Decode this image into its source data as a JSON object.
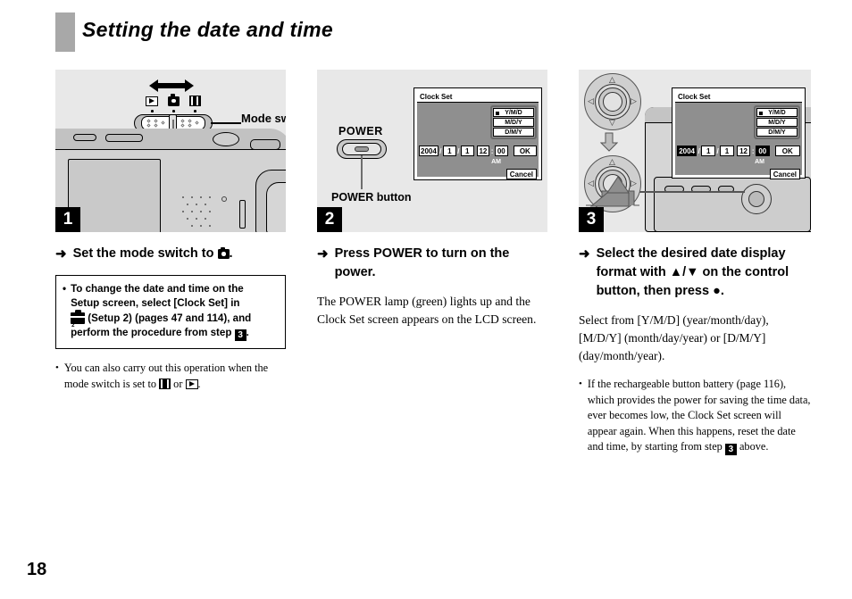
{
  "page": {
    "title": "Setting the date and time",
    "number": "18"
  },
  "steps": [
    {
      "badge": "1",
      "illustration_labels": {
        "mode_switch": "Mode switch"
      },
      "heading_arrow": "➜",
      "heading_pre": "Set the mode switch to ",
      "heading_post": ".",
      "note_box": {
        "bullet": "•",
        "line1": "To change the date and time on the",
        "line2": "Setup screen, select [Clock Set] in",
        "line3_post": " (Setup 2) (pages 47 and 114), and",
        "line4_pre": "perform the procedure from step ",
        "line4_step": "3",
        "line4_post": "."
      },
      "bullet": {
        "marker": "•",
        "pre": "You can also carry out this operation when the mode switch is set to ",
        "mid": " or ",
        "post": "."
      }
    },
    {
      "badge": "2",
      "illustration_labels": {
        "power": "POWER",
        "power_button": "POWER button"
      },
      "heading_arrow": "➜",
      "heading": "Press POWER to turn on the power.",
      "body": "The POWER lamp (green) lights up and the Clock Set screen appears on the LCD screen."
    },
    {
      "badge": "3",
      "heading_arrow": "➜",
      "heading": "Select the desired date display format with ▲/▼ on the control button, then press ●.",
      "body": "Select from [Y/M/D] (year/month/day), [M/D/Y] (month/day/year) or [D/M/Y] (day/month/year).",
      "bullet": {
        "marker": "•",
        "pre": "If the rechargeable button battery (page 116), which provides the power for saving the time data, ever becomes low, the Clock Set screen will appear again. When this happens, reset the date and time, by starting from step ",
        "step": "3",
        "post": " above."
      }
    }
  ],
  "clock_set_screen": {
    "title": "Clock Set",
    "formats": [
      {
        "label": "Y/M/D",
        "selected": true
      },
      {
        "label": "M/D/Y",
        "selected": false
      },
      {
        "label": "D/M/Y",
        "selected": false
      }
    ],
    "year": "2004",
    "month": "1",
    "day": "1",
    "hour": "12",
    "minute": "00",
    "sep_date": "/",
    "sep_time": ":",
    "meridiem": "AM",
    "ok": "OK",
    "cancel": "Cancel"
  },
  "icons": {
    "mode_playback": "playback-icon",
    "mode_camera": "camera-icon",
    "mode_movie": "movie-icon",
    "setup": "setup-toolbox-icon"
  },
  "colors": {
    "header_bar": "#a8a8a8",
    "panel_background": "#e8e8e8",
    "badge_background": "#000000",
    "screen_background": "#8f8f8f"
  }
}
